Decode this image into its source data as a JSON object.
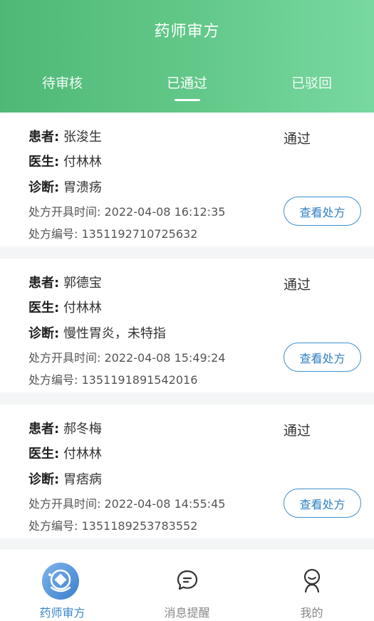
{
  "header": {
    "title": "药师审方"
  },
  "tabs": [
    {
      "label": "待审核",
      "active": false
    },
    {
      "label": "已通过",
      "active": true
    },
    {
      "label": "已驳回",
      "active": false
    }
  ],
  "field_labels": {
    "patient": "患者:",
    "doctor": "医生:",
    "diagnosis": "诊断:",
    "issue_time": "处方开具时间:",
    "prescription_no": "处方编号:"
  },
  "prescriptions": [
    {
      "patient": "张浚生",
      "doctor": "付林林",
      "diagnosis": "胃溃疡",
      "issue_time": "2022-04-08 16:12:35",
      "prescription_no": "1351192710725632",
      "status": "通过",
      "action_label": "查看处方"
    },
    {
      "patient": "郭德宝",
      "doctor": "付林林",
      "diagnosis": "慢性胃炎，未特指",
      "issue_time": "2022-04-08 15:49:24",
      "prescription_no": "1351191891542016",
      "status": "通过",
      "action_label": "查看处方"
    },
    {
      "patient": "郝冬梅",
      "doctor": "付林林",
      "diagnosis": "胃痞病",
      "issue_time": "2022-04-08 14:55:45",
      "prescription_no": "1351189253783552",
      "status": "通过",
      "action_label": "查看处方"
    }
  ],
  "bottom_nav": [
    {
      "label": "药师审方",
      "icon": "pharmacist-review-icon",
      "active": true
    },
    {
      "label": "消息提醒",
      "icon": "message-icon",
      "active": false
    },
    {
      "label": "我的",
      "icon": "profile-icon",
      "active": false
    }
  ],
  "colors": {
    "header_start": "#4fb877",
    "header_end": "#78d8a0",
    "accent_blue": "#3a86c8"
  }
}
